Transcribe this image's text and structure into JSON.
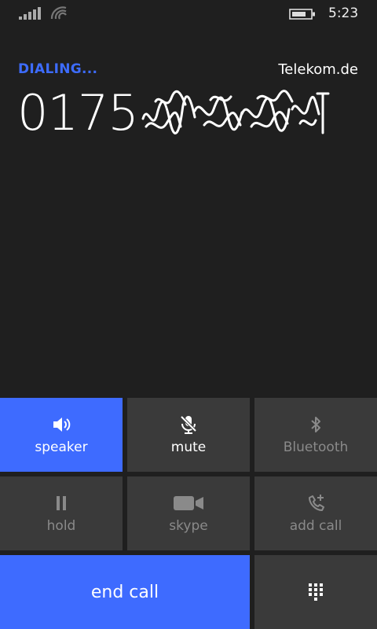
{
  "status_bar": {
    "time": "5:23",
    "signal_icon": "signal-bars-icon",
    "wifi_icon": "wifi-icon",
    "battery_icon": "battery-icon"
  },
  "call": {
    "status": "DIALING...",
    "carrier": "Telekom.de",
    "number_visible": "0175",
    "number_redaction": "scribbled-out digits"
  },
  "controls": {
    "speaker": {
      "label": "speaker",
      "icon": "speaker-icon",
      "state": "active"
    },
    "mute": {
      "label": "mute",
      "icon": "mic-muted-icon",
      "state": "enabled"
    },
    "bluetooth": {
      "label": "Bluetooth",
      "icon": "bluetooth-icon",
      "state": "disabled"
    },
    "hold": {
      "label": "hold",
      "icon": "pause-icon",
      "state": "disabled"
    },
    "skype": {
      "label": "skype",
      "icon": "video-camera-icon",
      "state": "disabled"
    },
    "add_call": {
      "label": "add call",
      "icon": "add-call-icon",
      "state": "disabled"
    },
    "end_call": {
      "label": "end call"
    },
    "keypad": {
      "icon": "keypad-icon"
    }
  },
  "colors": {
    "accent": "#3E6BFF",
    "background": "#1F1F1F",
    "button": "#3A3A3A"
  }
}
